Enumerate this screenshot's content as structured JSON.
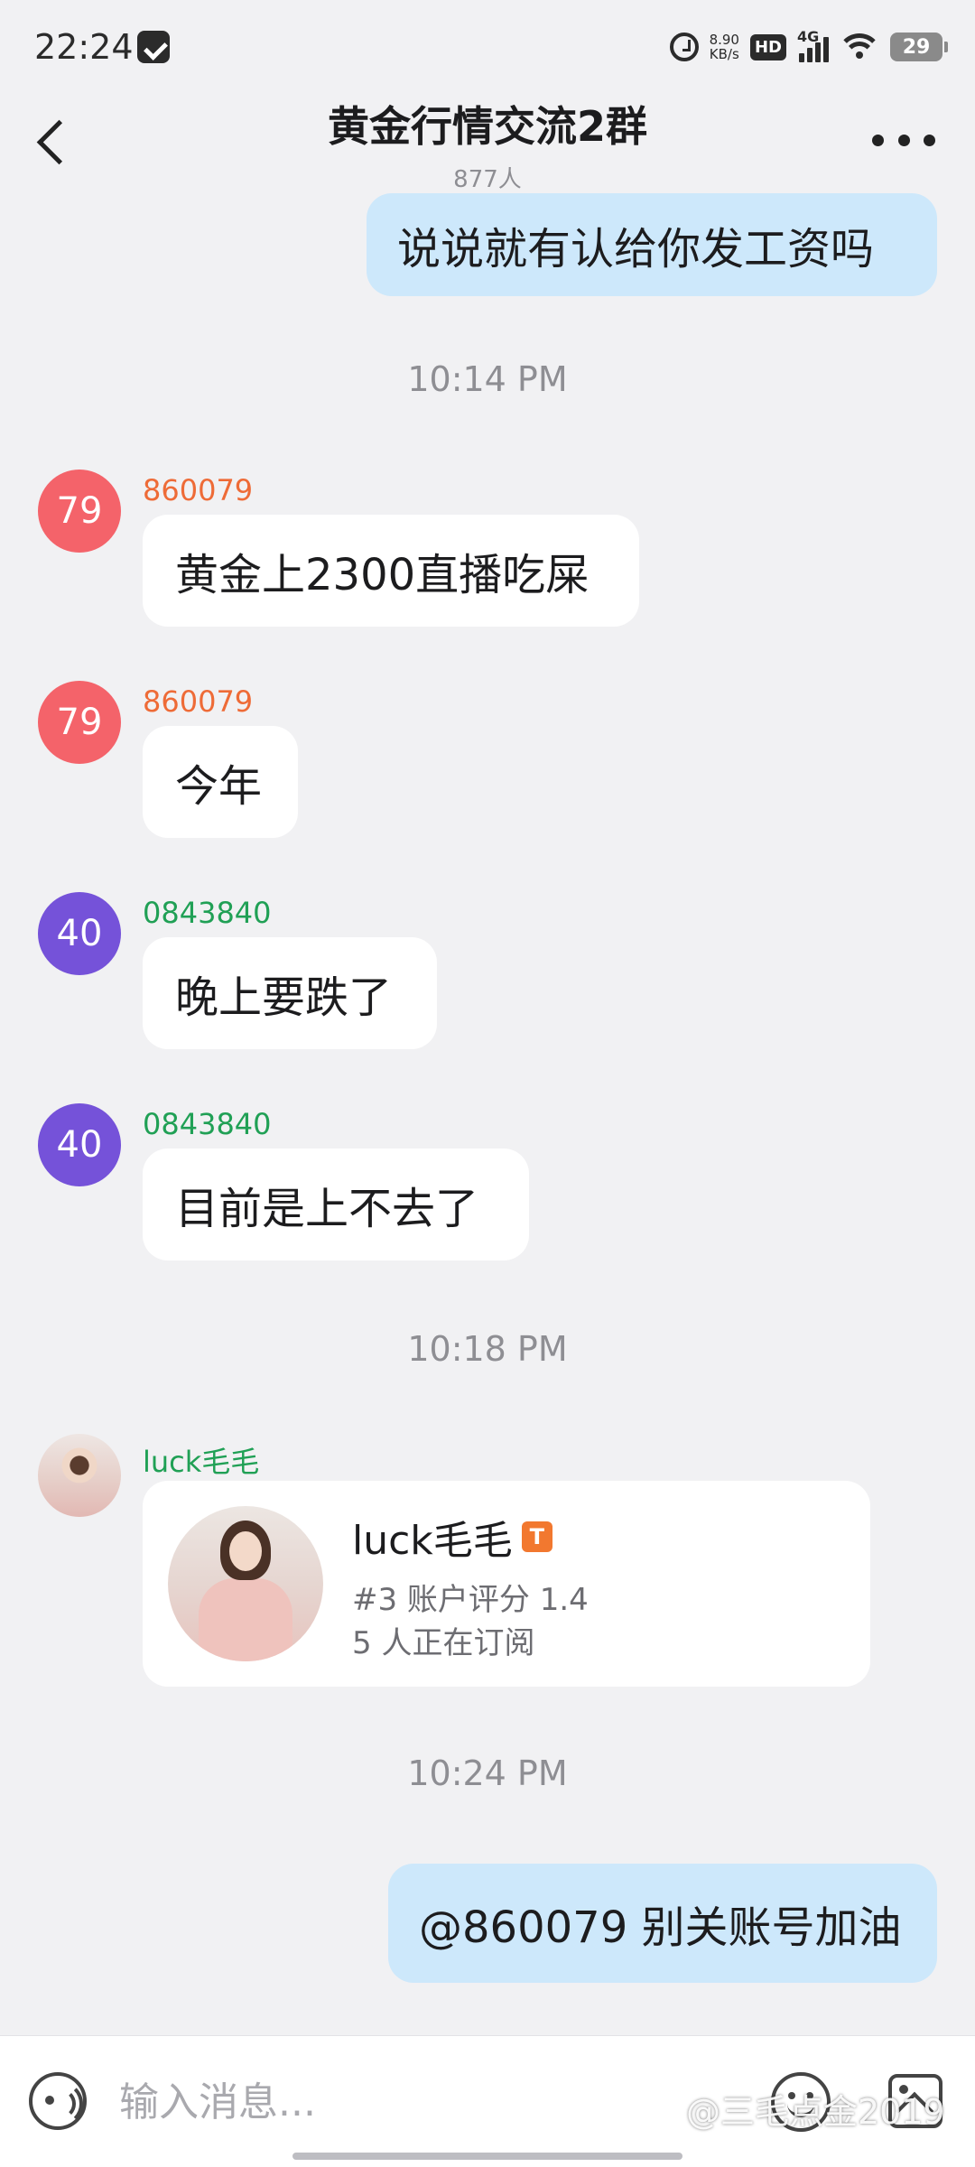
{
  "status_bar": {
    "time": "22:24",
    "speed_value": "8.90",
    "speed_unit": "KB/s",
    "hd": "HD",
    "network": "4G",
    "battery": "29"
  },
  "header": {
    "title": "黄金行情交流2群",
    "member_count": "877人"
  },
  "messages": {
    "out_1": "说说就有认给你发工资吗",
    "time_1": "10:14 PM",
    "in": [
      {
        "avatar_text": "79",
        "sender": "860079",
        "text": "黄金上2300直播吃屎"
      },
      {
        "avatar_text": "79",
        "sender": "860079",
        "text": "今年"
      },
      {
        "avatar_text": "40",
        "sender": "0843840",
        "text": "晚上要跌了"
      },
      {
        "avatar_text": "40",
        "sender": "0843840",
        "text": "目前是上不去了"
      }
    ],
    "time_2": "10:18 PM",
    "card_sender": "luck毛毛",
    "card": {
      "name": "luck毛毛",
      "badge": "T",
      "rating": "#3 账户评分 1.4",
      "subscribers": "5 人正在订阅"
    },
    "time_3": "10:24 PM",
    "out_2": "@860079 别关账号加油"
  },
  "input": {
    "placeholder": "输入消息..."
  },
  "watermark": "@三毛点金2019",
  "colors": {
    "outgoing_bubble": "#cde8fb",
    "avatar_red": "#f4636a",
    "avatar_purple": "#7552d9",
    "sender_orange": "#ee6b37",
    "sender_green": "#20a055",
    "badge_orange": "#f2782f"
  }
}
